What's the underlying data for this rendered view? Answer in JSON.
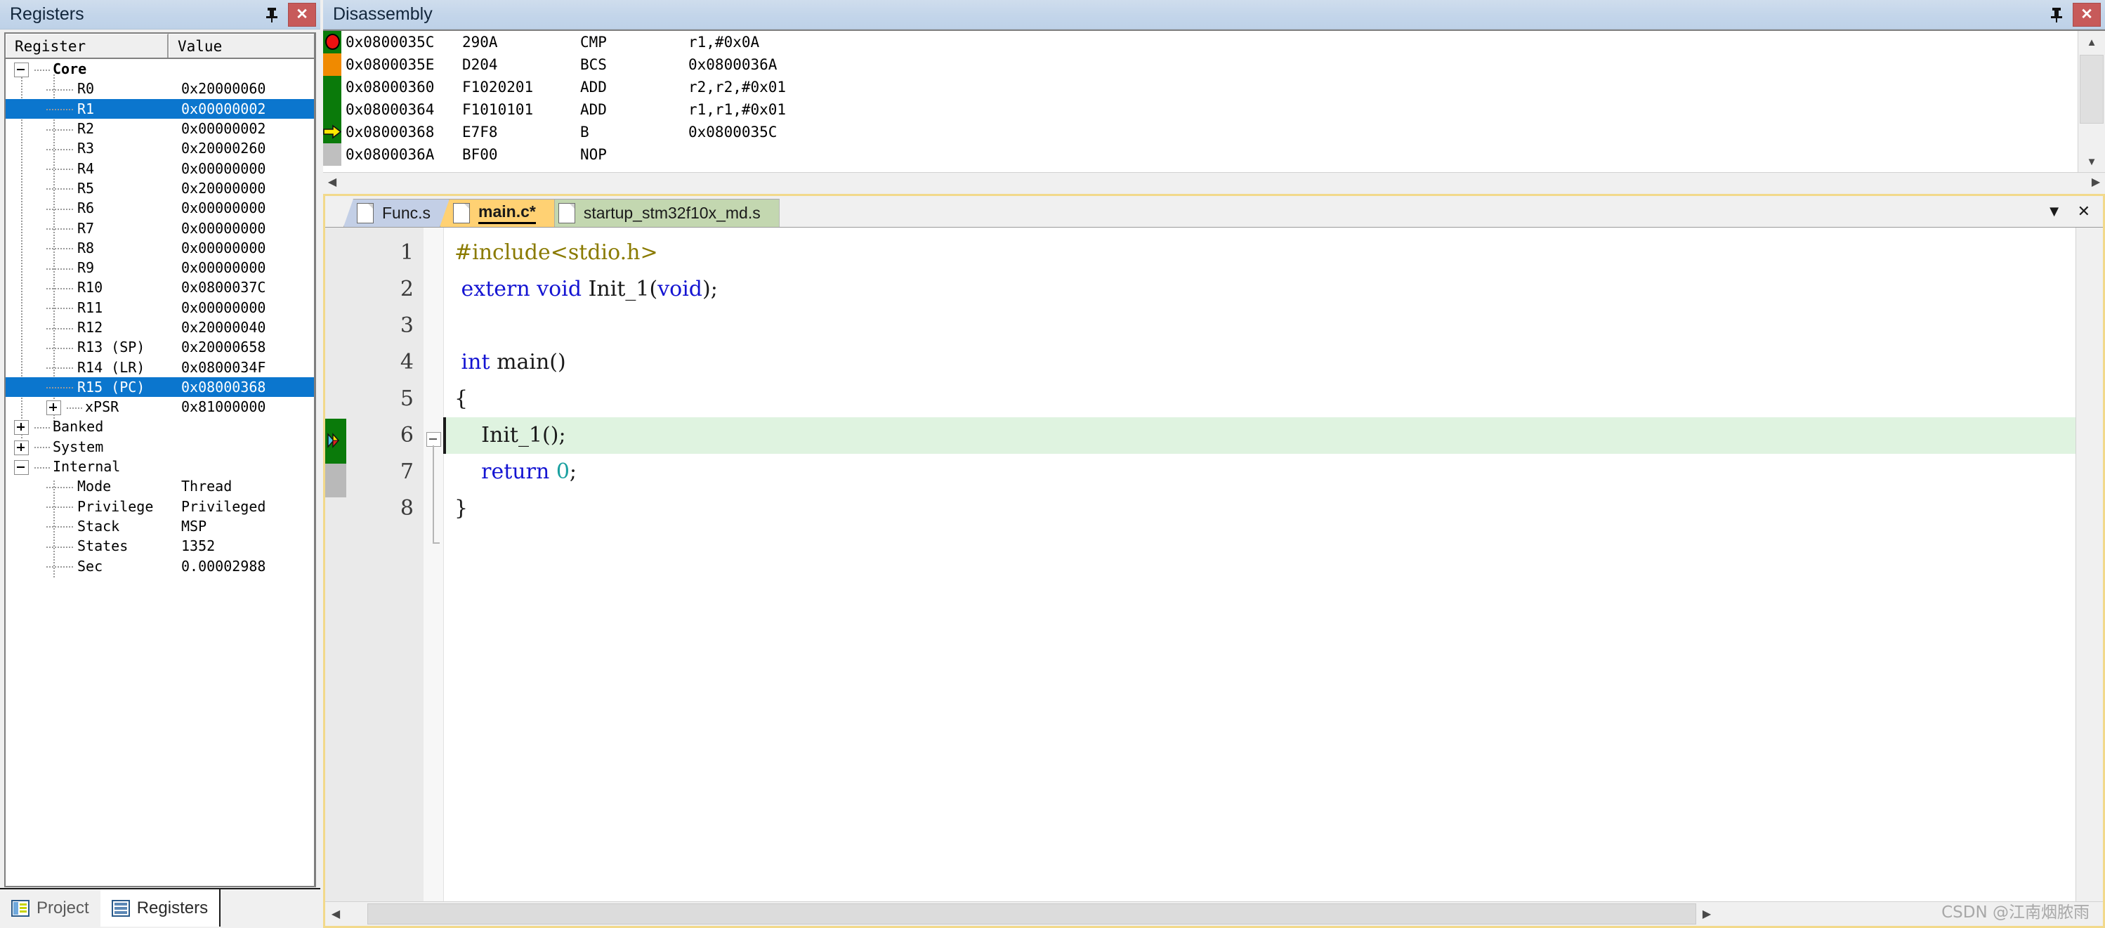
{
  "registers_panel": {
    "title": "Registers",
    "pin_icon": "pin-icon",
    "close_icon": "close-icon",
    "columns": [
      "Register",
      "Value"
    ],
    "rows": [
      {
        "indent": 0,
        "toggle": "minus",
        "name": "Core",
        "value": "",
        "selected": false,
        "bold": true
      },
      {
        "indent": 1,
        "toggle": "none",
        "name": "R0",
        "value": "0x20000060",
        "selected": false
      },
      {
        "indent": 1,
        "toggle": "none",
        "name": "R1",
        "value": "0x00000002",
        "selected": true
      },
      {
        "indent": 1,
        "toggle": "none",
        "name": "R2",
        "value": "0x00000002",
        "selected": false
      },
      {
        "indent": 1,
        "toggle": "none",
        "name": "R3",
        "value": "0x20000260",
        "selected": false
      },
      {
        "indent": 1,
        "toggle": "none",
        "name": "R4",
        "value": "0x00000000",
        "selected": false
      },
      {
        "indent": 1,
        "toggle": "none",
        "name": "R5",
        "value": "0x20000000",
        "selected": false
      },
      {
        "indent": 1,
        "toggle": "none",
        "name": "R6",
        "value": "0x00000000",
        "selected": false
      },
      {
        "indent": 1,
        "toggle": "none",
        "name": "R7",
        "value": "0x00000000",
        "selected": false
      },
      {
        "indent": 1,
        "toggle": "none",
        "name": "R8",
        "value": "0x00000000",
        "selected": false
      },
      {
        "indent": 1,
        "toggle": "none",
        "name": "R9",
        "value": "0x00000000",
        "selected": false
      },
      {
        "indent": 1,
        "toggle": "none",
        "name": "R10",
        "value": "0x0800037C",
        "selected": false
      },
      {
        "indent": 1,
        "toggle": "none",
        "name": "R11",
        "value": "0x00000000",
        "selected": false
      },
      {
        "indent": 1,
        "toggle": "none",
        "name": "R12",
        "value": "0x20000040",
        "selected": false
      },
      {
        "indent": 1,
        "toggle": "none",
        "name": "R13 (SP)",
        "value": "0x20000658",
        "selected": false
      },
      {
        "indent": 1,
        "toggle": "none",
        "name": "R14 (LR)",
        "value": "0x0800034F",
        "selected": false
      },
      {
        "indent": 1,
        "toggle": "none",
        "name": "R15 (PC)",
        "value": "0x08000368",
        "selected": true
      },
      {
        "indent": 1,
        "toggle": "plus",
        "name": "xPSR",
        "value": "0x81000000",
        "selected": false
      },
      {
        "indent": 0,
        "toggle": "plus",
        "name": "Banked",
        "value": "",
        "selected": false
      },
      {
        "indent": 0,
        "toggle": "plus",
        "name": "System",
        "value": "",
        "selected": false
      },
      {
        "indent": 0,
        "toggle": "minus",
        "name": "Internal",
        "value": "",
        "selected": false
      },
      {
        "indent": 1,
        "toggle": "none",
        "name": "Mode",
        "value": "Thread",
        "selected": false
      },
      {
        "indent": 1,
        "toggle": "none",
        "name": "Privilege",
        "value": "Privileged",
        "selected": false
      },
      {
        "indent": 1,
        "toggle": "none",
        "name": "Stack",
        "value": "MSP",
        "selected": false
      },
      {
        "indent": 1,
        "toggle": "none",
        "name": "States",
        "value": "1352",
        "selected": false
      },
      {
        "indent": 1,
        "toggle": "none",
        "name": "Sec",
        "value": "0.00002988",
        "selected": false
      }
    ],
    "bottom_tabs": [
      {
        "label": "Project",
        "icon": "project-icon",
        "active": false
      },
      {
        "label": "Registers",
        "icon": "registers-icon",
        "active": true
      }
    ]
  },
  "disassembly": {
    "title": "Disassembly",
    "pin_icon": "pin-icon",
    "close_icon": "close-icon",
    "rows": [
      {
        "gutter": "breakpoint",
        "address": "0x0800035C",
        "opcode": "290A",
        "mnemonic": "CMP",
        "operands": "r1,#0x0A"
      },
      {
        "gutter": "orange",
        "address": "0x0800035E",
        "opcode": "D204",
        "mnemonic": "BCS",
        "operands": "0x0800036A"
      },
      {
        "gutter": "green",
        "address": "0x08000360",
        "opcode": "F1020201",
        "mnemonic": "ADD",
        "operands": "r2,r2,#0x01"
      },
      {
        "gutter": "green",
        "address": "0x08000364",
        "opcode": "F1010101",
        "mnemonic": "ADD",
        "operands": "r1,r1,#0x01"
      },
      {
        "gutter": "pc",
        "address": "0x08000368",
        "opcode": "E7F8",
        "mnemonic": "B",
        "operands": "0x0800035C"
      },
      {
        "gutter": "grey",
        "address": "0x0800036A",
        "opcode": "BF00",
        "mnemonic": "NOP",
        "operands": ""
      }
    ],
    "scroll_up_icon": "scroll-up-icon",
    "scroll_down_icon": "scroll-down-icon",
    "scroll_left_icon": "scroll-left-icon",
    "scroll_right_icon": "scroll-right-icon"
  },
  "editor": {
    "tabs": [
      {
        "label": "Func.s",
        "modified": false,
        "active": false,
        "color": "blue"
      },
      {
        "label": "main.c*",
        "modified": true,
        "active": true,
        "color": "amber"
      },
      {
        "label": "startup_stm32f10x_md.s",
        "modified": false,
        "active": false,
        "color": "green"
      }
    ],
    "tabstrip_dropdown_icon": "chevron-down-icon",
    "tabstrip_close_icon": "close-icon",
    "line_numbers": [
      "1",
      "2",
      "3",
      "4",
      "5",
      "6",
      "7",
      "8"
    ],
    "code_lines": [
      {
        "n": 1,
        "highlight": false,
        "tokens": [
          {
            "t": "#include<stdio.h>",
            "c": "pre"
          }
        ]
      },
      {
        "n": 2,
        "highlight": false,
        "tokens": [
          {
            "t": " ",
            "c": "plain"
          },
          {
            "t": "extern void ",
            "c": "kw"
          },
          {
            "t": "Init_1(",
            "c": "plain"
          },
          {
            "t": "void",
            "c": "kw"
          },
          {
            "t": ");",
            "c": "plain"
          }
        ]
      },
      {
        "n": 3,
        "highlight": false,
        "tokens": [
          {
            "t": "",
            "c": "plain"
          }
        ]
      },
      {
        "n": 4,
        "highlight": false,
        "tokens": [
          {
            "t": " ",
            "c": "plain"
          },
          {
            "t": "int ",
            "c": "kw"
          },
          {
            "t": "main()",
            "c": "plain"
          }
        ]
      },
      {
        "n": 5,
        "highlight": false,
        "tokens": [
          {
            "t": "{",
            "c": "plain"
          }
        ]
      },
      {
        "n": 6,
        "highlight": true,
        "tokens": [
          {
            "t": "    Init_1();",
            "c": "plain"
          }
        ]
      },
      {
        "n": 7,
        "highlight": false,
        "tokens": [
          {
            "t": "    ",
            "c": "plain"
          },
          {
            "t": "return ",
            "c": "kw"
          },
          {
            "t": "0",
            "c": "num"
          },
          {
            "t": ";",
            "c": "plain"
          }
        ]
      },
      {
        "n": 8,
        "highlight": false,
        "tokens": [
          {
            "t": "}",
            "c": "plain"
          }
        ]
      }
    ],
    "fold_marker_icon": "fold-minus-icon",
    "exec_marker_icon": "execution-point-icon"
  },
  "watermark": "CSDN @江南烟脓雨",
  "colors": {
    "selection_blue": "#0b76ce",
    "breakpoint_red": "#ee1111",
    "pc_yellow": "#ffe800",
    "gutter_green": "#0a7a0a",
    "gutter_orange": "#f08a00",
    "highlight_green": "#dff3e0",
    "tab_amber": "#ffd173",
    "tab_blue": "#c3cfe6",
    "tab_green": "#c3d7b0",
    "titlebar_blue": "#c3d5ea",
    "editor_border": "#f2d98b"
  }
}
